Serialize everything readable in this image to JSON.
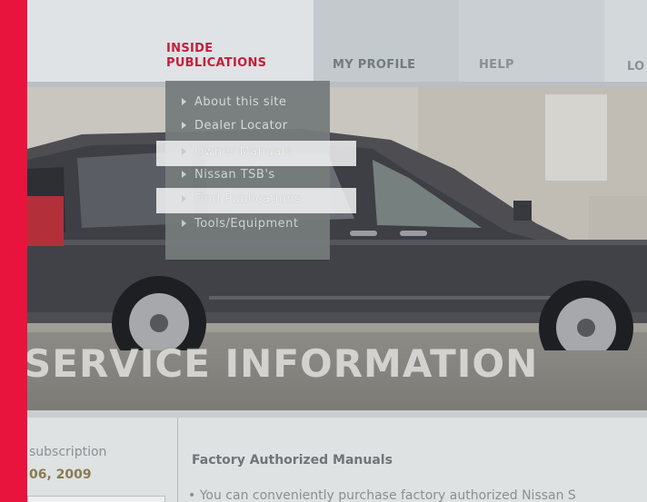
{
  "nav": {
    "inside_line1": "INSIDE",
    "inside_line2": "PUBLICATIONS",
    "my_profile": "MY PROFILE",
    "help": "HELP",
    "last": "LO"
  },
  "dropdown": {
    "items": [
      {
        "label": "About this site",
        "highlighted": false
      },
      {
        "label": "Dealer Locator",
        "highlighted": false
      },
      {
        "label": "Owner Manuals",
        "highlighted": true
      },
      {
        "label": "Nissan TSB's",
        "highlighted": false
      },
      {
        "label": "Find Publications",
        "highlighted": true
      },
      {
        "label": "Tools/Equipment",
        "highlighted": false
      }
    ]
  },
  "hero": {
    "title": "SERVICE INFORMATION"
  },
  "sidebar": {
    "subscription_text": "subscription",
    "date_text": "06, 2009"
  },
  "main": {
    "section_title": "Factory Authorized Manuals",
    "bullet_text": "• You can conveniently purchase factory authorized Nissan S"
  },
  "colors": {
    "accent_red": "#e8143e",
    "nav_active": "#c31f3d",
    "dropdown_bg": "#767b7c"
  }
}
